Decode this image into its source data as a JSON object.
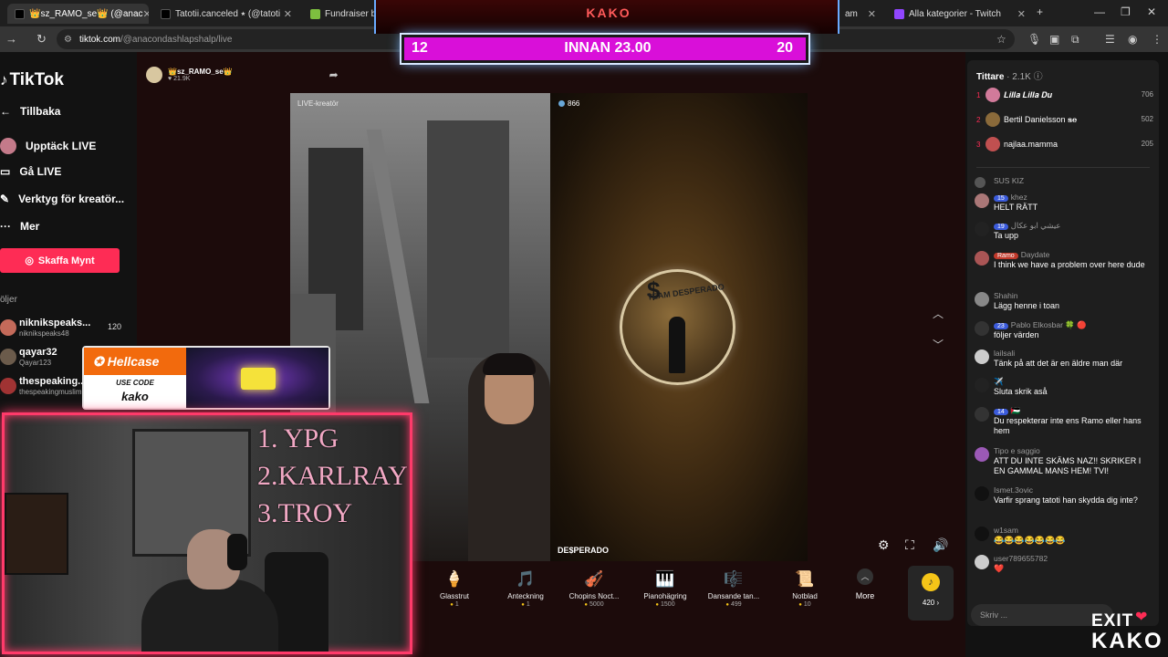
{
  "browser": {
    "tabs": [
      {
        "label": "👑sz_RAMO_se👑 (@anac",
        "active": true,
        "color": "#111111"
      },
      {
        "label": "Tatotii.canceled ⭑ (@tatoti",
        "active": false,
        "color": "#111111"
      },
      {
        "label": "Fundraiser by",
        "active": false,
        "color": "#7dbf3f"
      },
      {
        "label": "am",
        "active": false,
        "color": "#5a5a5a"
      },
      {
        "label": "Alla kategorier - Twitch",
        "active": false,
        "color": "#9146ff"
      }
    ],
    "url_host": "tiktok.com",
    "url_path": "/@anacondashlapshalp/live"
  },
  "sidebar": {
    "logo": "TikTok",
    "back": "Tillbaka",
    "items": [
      {
        "label": "Upptäck LIVE"
      },
      {
        "label": "Gå LIVE"
      },
      {
        "label": "Verktyg för kreatör..."
      },
      {
        "label": "Mer"
      }
    ],
    "coins_button": "Skaffa Mynt",
    "following_header": "öljer",
    "following": [
      {
        "name": "niknikspeaks...",
        "handle": "niknikspeaks48",
        "count": "120",
        "color": "#c46a5a"
      },
      {
        "name": "qayar32",
        "handle": "Qayar123",
        "count": "",
        "color": "#6b5b4b"
      },
      {
        "name": "thespeaking...",
        "handle": "thespeakingmuslim",
        "count": "",
        "color": "#a03333"
      }
    ]
  },
  "live": {
    "host_name": "👑sz_RAMO_se👑",
    "host_likes": "♥ 21.9K",
    "left_label": "LIVE-kreatör",
    "right_viewers": "866",
    "opponent_name": "DE$PERADO",
    "orb_text": "TEAM DESPERADO"
  },
  "gifts": [
    {
      "name": "Glasstrut",
      "price": "1",
      "icon": "🍦"
    },
    {
      "name": "Anteckning",
      "price": "1",
      "icon": "🎵"
    },
    {
      "name": "Chopins Noct...",
      "price": "5000",
      "icon": "🎻"
    },
    {
      "name": "Pianohägring",
      "price": "1500",
      "icon": "🎹"
    },
    {
      "name": "Dansande tan...",
      "price": "499",
      "icon": "🎼"
    },
    {
      "name": "Notblad",
      "price": "10",
      "icon": "📜"
    }
  ],
  "more_label": "More",
  "coins_balance": "420 ›",
  "chat": {
    "viewers_label": "Tittare",
    "viewers_count": "· 2.1K",
    "top_viewers": [
      {
        "rank": "1",
        "name": "𝑳𝒊𝒍𝒍𝒂 𝑳𝒊𝒍𝒍𝒂 𝑫𝒖",
        "count": "706",
        "color": "#d17a9a"
      },
      {
        "rank": "2",
        "name": "Bertil Danielsson 𝐬𝐞",
        "count": "502",
        "color": "#8a6a3a"
      },
      {
        "rank": "3",
        "name": "najlaa.mamma",
        "count": "205",
        "color": "#c05050"
      }
    ],
    "messages": [
      {
        "user": "SUS KIZ",
        "badge": "",
        "text": "",
        "color": "#555555"
      },
      {
        "user": "khez",
        "badge": "15",
        "text": "HELT RÄTT",
        "color": "#a77"
      },
      {
        "user": "عيشي ابو عكال",
        "badge": "19",
        "text": "Ta upp",
        "color": "#222"
      },
      {
        "user": "Daydate",
        "badge": "Ramo",
        "text": "I think we have a problem over here dude",
        "color": "#a55"
      },
      {
        "user": "Shahin",
        "badge": "",
        "text": "Lägg henne i toan",
        "color": "#888"
      },
      {
        "user": "Pablo Elkosbar 🍀 🔴",
        "badge": "23",
        "text": "följer värden",
        "color": "#333"
      },
      {
        "user": "lailsali",
        "badge": "",
        "text": "Tänk på att det är en äldre man där",
        "color": "#ccc"
      },
      {
        "user": "✈️",
        "badge": "",
        "text": "Sluta skrik aså",
        "color": "#222"
      },
      {
        "user": "🇵🇸",
        "badge": "14",
        "text": "Du respekterar inte ens Ramo eller hans hem",
        "color": "#333"
      },
      {
        "user": "Tipo e saggio",
        "badge": "",
        "text": "ATT DU INTE SKÄMS NAZ!! SKRIKER I EN GAMMAL MANS HEM! TVI!",
        "color": "#9b59b6"
      },
      {
        "user": "Ismet.3ovic",
        "badge": "",
        "text": "Varfir sprang tatoti han skydda dig inte?",
        "color": "#111"
      },
      {
        "user": "w1sam",
        "badge": "",
        "text": "😂😂😂😂😂😂😂",
        "color": "#111"
      },
      {
        "user": "user789655782",
        "badge": "",
        "text": "❤️",
        "color": "#ccc"
      }
    ],
    "input_placeholder": "Skriv ..."
  },
  "overlay": {
    "banner": "KAKO",
    "score_left": "12",
    "score_title": "INNAN 23.00",
    "score_right": "20",
    "hellcase_brand": "Hellcase",
    "hellcase_use": "USE CODE",
    "hellcase_code": "kako",
    "ranks": [
      "1. YPG",
      "2.KARLRAY",
      "3.TROY"
    ],
    "logo_top": "EXIT",
    "logo_bottom": "KAKO"
  }
}
